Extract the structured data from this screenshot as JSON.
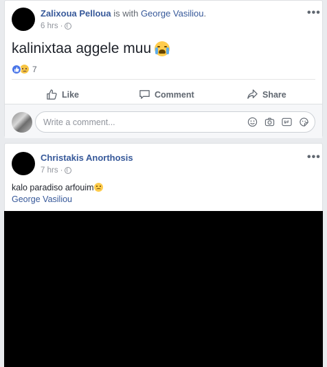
{
  "post1": {
    "author": "Zalixoua Pelloua",
    "with_text": " is with ",
    "tagged": "George Vasiliou",
    "tagged_suffix": ".",
    "time": "6 hrs",
    "time_sep": "·",
    "content": "kalinixtaa aggele muu",
    "reaction_count": "7",
    "actions": {
      "like": "Like",
      "comment": "Comment",
      "share": "Share"
    },
    "comment_placeholder": "Write a comment..."
  },
  "post2": {
    "author": "Christakis Anorthosis",
    "time": "7 hrs",
    "time_sep": "·",
    "content": "kalo paradiso arfouim",
    "mention": "George Vasiliou"
  },
  "colors": {
    "link": "#365899",
    "like_blue": "#4a76e8",
    "background": "#e9ebee"
  },
  "icons": [
    "privacy-globe-icon",
    "more-options-icon",
    "like-icon",
    "comment-icon",
    "share-icon",
    "emoji-icon",
    "camera-icon",
    "gif-icon",
    "sticker-icon",
    "loudly-crying-emoji",
    "sad-emoji"
  ]
}
